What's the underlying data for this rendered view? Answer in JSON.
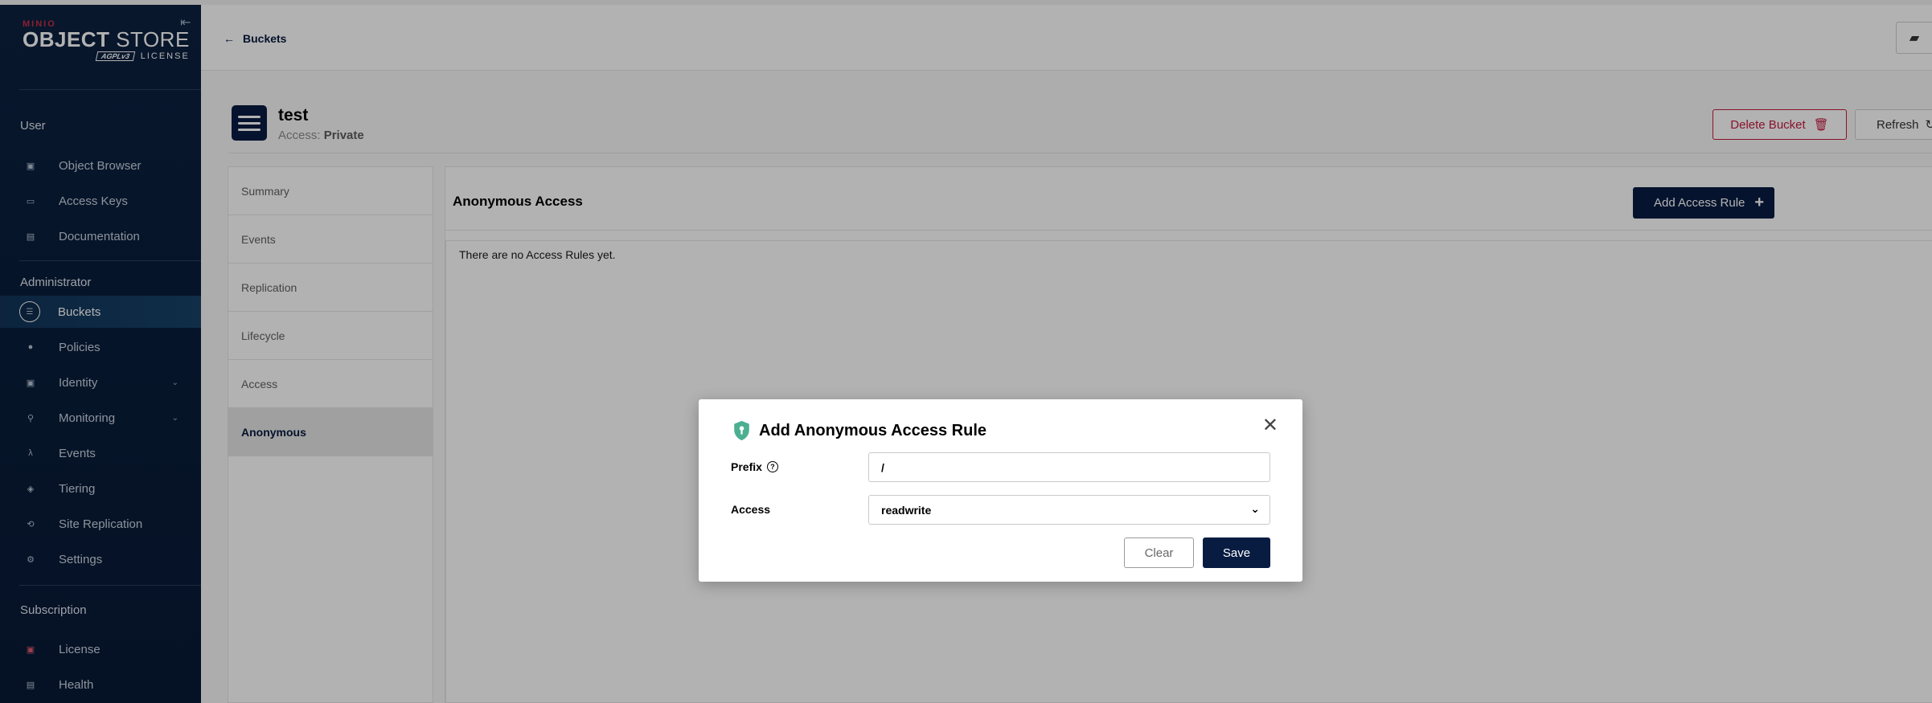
{
  "logo": {
    "brand": "MINIO",
    "product_bold": "OBJECT",
    "product_light": " STORE",
    "badge": "AGPLv3",
    "license_label": "LICENSE"
  },
  "sidebar": {
    "sections": [
      {
        "title": "User",
        "items": [
          {
            "label": "Object Browser",
            "icon": "object-browser-icon"
          },
          {
            "label": "Access Keys",
            "icon": "access-keys-icon"
          },
          {
            "label": "Documentation",
            "icon": "documentation-icon"
          }
        ]
      },
      {
        "title": "Administrator",
        "items": [
          {
            "label": "Buckets",
            "icon": "buckets-icon",
            "active": true
          },
          {
            "label": "Policies",
            "icon": "policies-icon"
          },
          {
            "label": "Identity",
            "icon": "identity-icon",
            "expandable": true
          },
          {
            "label": "Monitoring",
            "icon": "monitoring-icon",
            "expandable": true
          },
          {
            "label": "Events",
            "icon": "lambda-icon"
          },
          {
            "label": "Tiering",
            "icon": "tiering-icon"
          },
          {
            "label": "Site Replication",
            "icon": "site-replication-icon"
          },
          {
            "label": "Settings",
            "icon": "settings-icon"
          }
        ]
      },
      {
        "title": "Subscription",
        "items": [
          {
            "label": "License",
            "icon": "license-icon"
          },
          {
            "label": "Health",
            "icon": "health-icon"
          }
        ]
      }
    ]
  },
  "header": {
    "back_label": "Buckets"
  },
  "bucket": {
    "name": "test",
    "access_prefix": "Access:",
    "access_value": "Private"
  },
  "actions": {
    "delete_label": "Delete Bucket",
    "refresh_label": "Refresh"
  },
  "tabs": [
    {
      "label": "Summary"
    },
    {
      "label": "Events"
    },
    {
      "label": "Replication"
    },
    {
      "label": "Lifecycle"
    },
    {
      "label": "Access"
    },
    {
      "label": "Anonymous",
      "active": true
    }
  ],
  "content": {
    "title": "Anonymous Access",
    "add_button_label": "Add Access Rule",
    "empty_message": "There are no Access Rules yet."
  },
  "modal": {
    "title": "Add Anonymous Access Rule",
    "prefix_label": "Prefix",
    "prefix_value": "/",
    "access_label": "Access",
    "access_value": "readwrite",
    "clear_label": "Clear",
    "save_label": "Save"
  },
  "colors": {
    "primary": "#081c42",
    "danger": "#c51b3f",
    "shield": "#4caf92"
  }
}
